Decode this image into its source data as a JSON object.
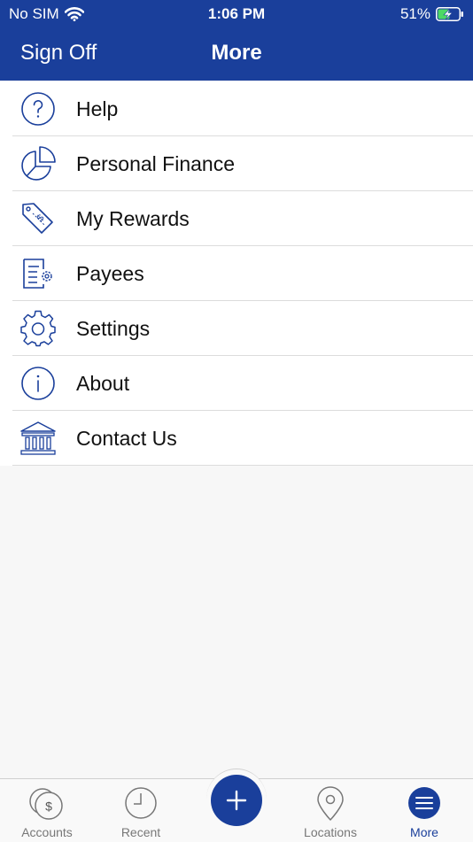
{
  "status_bar": {
    "carrier": "No SIM",
    "time": "1:06 PM",
    "battery": "51%"
  },
  "nav": {
    "left_label": "Sign Off",
    "title": "More"
  },
  "menu": [
    {
      "label": "Help",
      "icon": "help-circle-icon"
    },
    {
      "label": "Personal Finance",
      "icon": "pie-chart-icon"
    },
    {
      "label": "My Rewards",
      "icon": "reward-tag-icon"
    },
    {
      "label": "Payees",
      "icon": "payee-document-icon"
    },
    {
      "label": "Settings",
      "icon": "gear-icon"
    },
    {
      "label": "About",
      "icon": "info-circle-icon"
    },
    {
      "label": "Contact Us",
      "icon": "bank-icon"
    }
  ],
  "tabs": [
    {
      "label": "Accounts",
      "icon": "coins-icon"
    },
    {
      "label": "Recent",
      "icon": "clock-icon"
    },
    {
      "label": "Locations",
      "icon": "location-pin-icon"
    },
    {
      "label": "More",
      "icon": "menu-icon",
      "active": true
    }
  ],
  "fab": {
    "icon": "plus-icon"
  },
  "colors": {
    "brand": "#1a3f9b",
    "icon_stroke": "#1a3f9b",
    "tab_inactive": "#777777"
  }
}
